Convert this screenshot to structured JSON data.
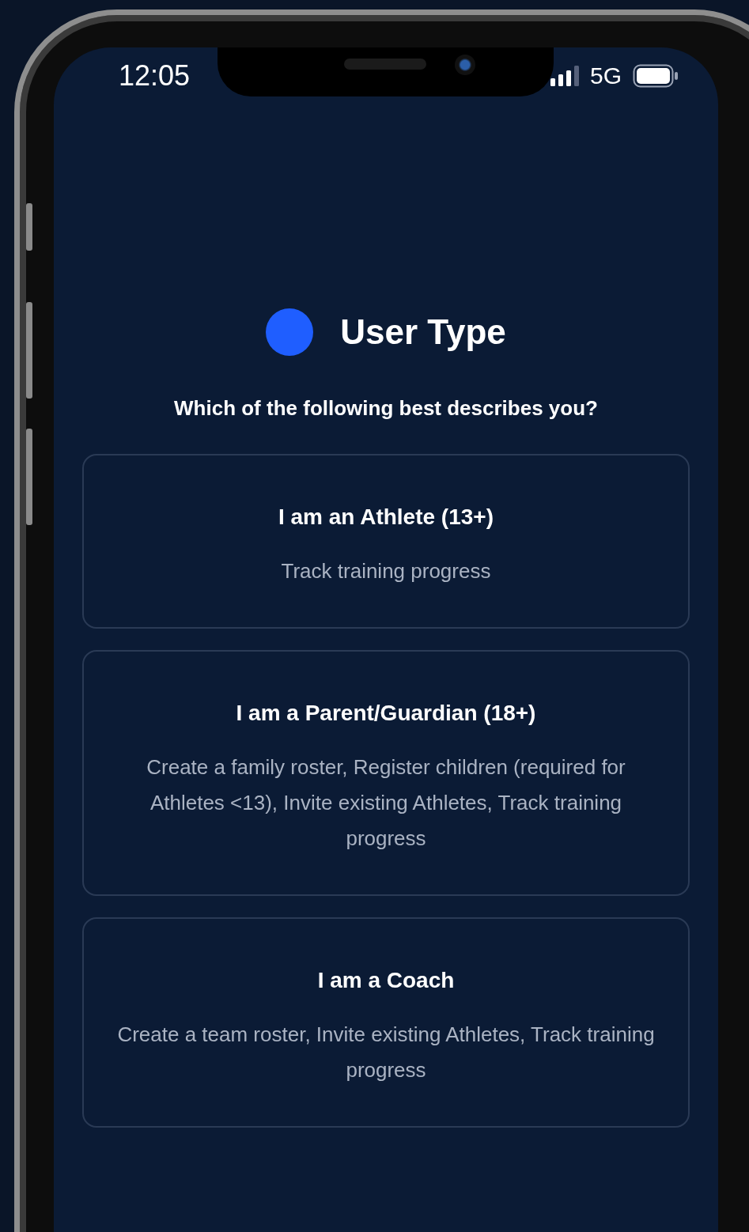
{
  "status_bar": {
    "time": "12:05",
    "network": "5G"
  },
  "header": {
    "title": "User Type",
    "subtitle": "Which of the following best describes you?"
  },
  "options": [
    {
      "title": "I am an Athlete (13+)",
      "description": "Track training progress"
    },
    {
      "title": "I am a Parent/Guardian (18+)",
      "description": "Create a family roster, Register children (required for Athletes <13), Invite existing Athletes, Track training progress"
    },
    {
      "title": "I am a Coach",
      "description": "Create a team roster, Invite existing Athletes, Track training progress"
    }
  ]
}
